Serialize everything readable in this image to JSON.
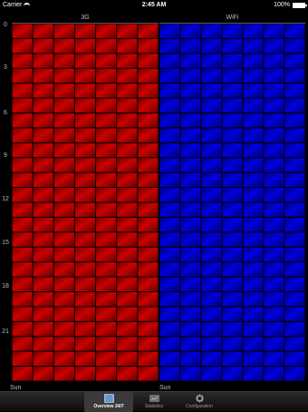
{
  "status_bar": {
    "carrier": "Carrier",
    "time": "2:45 AM",
    "battery": "100%"
  },
  "columns": [
    {
      "title": "3G",
      "color": "#cc0000",
      "day_label": "Sun"
    },
    {
      "title": "WiFi",
      "color": "#0000e0",
      "day_label": "Sun"
    }
  ],
  "hour_labels": [
    "0",
    "3",
    "6",
    "9",
    "12",
    "15",
    "18",
    "21"
  ],
  "grid": {
    "columns_per_section": 7,
    "rows": 24
  },
  "tabs": [
    {
      "label": "Overview 24/7",
      "icon": "overview-grid-icon",
      "selected": true
    },
    {
      "label": "Statistics",
      "icon": "statistics-icon",
      "selected": false
    },
    {
      "label": "Configuration",
      "icon": "gear-icon",
      "selected": false
    }
  ]
}
